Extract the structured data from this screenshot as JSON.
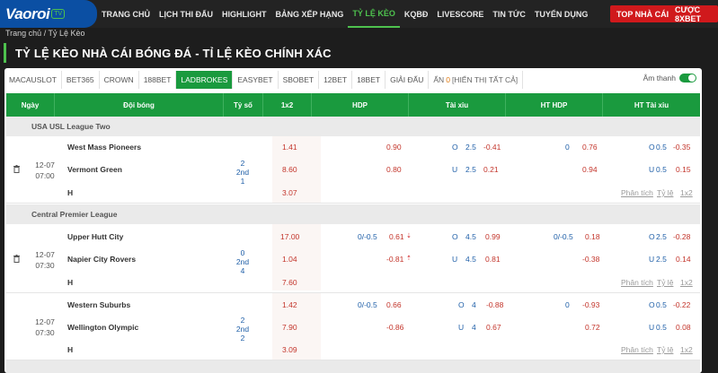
{
  "header": {
    "logo": "Vaoroi",
    "logo_badge": "TV",
    "menu": [
      "TRANG CHỦ",
      "LỊCH THI ĐẤU",
      "HIGHLIGHT",
      "BẢNG XẾP HẠNG",
      "TỶ LỆ KÈO",
      "KQBĐ",
      "LIVESCORE",
      "TIN TỨC",
      "TUYỂN DỤNG"
    ],
    "active_menu": "TỶ LỆ KÈO",
    "btn_top": "TOP NHÀ CÁI",
    "btn_bet": "CƯỢC 8XBET"
  },
  "breadcrumb": "Trang chủ  / Tỷ Lệ Kèo",
  "page_title": "TỶ LỆ KÈO NHÀ CÁI BÓNG ĐÁ - TỈ LỆ KÈO CHÍNH XÁC",
  "tabs": [
    "MACAUSLOT",
    "BET365",
    "CROWN",
    "188BET",
    "LADBROKES",
    "EASYBET",
    "SBOBET",
    "12BET",
    "18BET",
    "GIẢI ĐẤU"
  ],
  "active_tab": "LADBROKES",
  "filter": {
    "hidden_label": "ẨN",
    "hidden_count": "0",
    "show_all": "[HIỂN THỊ TẤT CẢ]"
  },
  "sound_label": "Âm thanh",
  "columns": [
    "Ngày",
    "Đội bóng",
    "Tỷ số",
    "1x2",
    "HDP",
    "Tài xỉu",
    "HT HDP",
    "HT Tài xỉu"
  ],
  "links": {
    "analysis": "Phân tích",
    "odds": "Tỷ lệ",
    "x12": "1x2"
  },
  "leagues": [
    {
      "name": "USA USL League Two",
      "match": {
        "date": "12-07",
        "time": "07:00",
        "home": "West Mass Pioneers",
        "away": "Vermont Green",
        "draw": "H",
        "score": [
          "2",
          "2nd",
          "1"
        ],
        "x12": [
          "1.41",
          "8.60",
          "3.07"
        ],
        "hdp": {
          "line1": "",
          "odd1": "0.90",
          "line2": "",
          "odd2": "0.80"
        },
        "ou": {
          "o_label": "O",
          "o_line": "2.5",
          "o_odd": "-0.41",
          "u_label": "U",
          "u_line": "2.5",
          "u_odd": "0.21"
        },
        "ht_hdp": {
          "line1": "0",
          "odd1": "0.76",
          "odd2": "0.94"
        },
        "ht_ou": {
          "o_label": "O",
          "o_line": "0.5",
          "o_odd": "-0.35",
          "u_label": "U",
          "u_line": "0.5",
          "u_odd": "0.15"
        }
      }
    },
    {
      "name": "Central Premier League",
      "match": {
        "date": "12-07",
        "time": "07:30",
        "home": "Upper Hutt City",
        "away": "Napier City Rovers",
        "draw": "H",
        "score": [
          "0",
          "2nd",
          "4"
        ],
        "x12": [
          "17.00",
          "1.04",
          "7.60"
        ],
        "hdp": {
          "line1": "0/-0.5",
          "odd1": "0.61",
          "odd2": "-0.81"
        },
        "ou": {
          "o_label": "O",
          "o_line": "4.5",
          "o_odd": "0.99",
          "u_label": "U",
          "u_line": "4.5",
          "u_odd": "0.81"
        },
        "ht_hdp": {
          "line1": "0/-0.5",
          "odd1": "0.18",
          "odd2": "-0.38"
        },
        "ht_ou": {
          "o_label": "O",
          "o_line": "2.5",
          "o_odd": "-0.28",
          "u_label": "U",
          "u_line": "2.5",
          "u_odd": "0.14"
        }
      }
    },
    {
      "name": "",
      "match": {
        "date": "12-07",
        "time": "07:30",
        "home": "Western Suburbs",
        "away": "Wellington Olympic",
        "draw": "H",
        "score": [
          "2",
          "2nd",
          "2"
        ],
        "x12": [
          "1.42",
          "7.90",
          "3.09"
        ],
        "hdp": {
          "line1": "0/-0.5",
          "odd1": "0.66",
          "odd2": "-0.86"
        },
        "ou": {
          "o_label": "O",
          "o_line": "4",
          "o_odd": "-0.88",
          "u_label": "U",
          "u_line": "4",
          "u_odd": "0.67"
        },
        "ht_hdp": {
          "line1": "0",
          "odd1": "-0.93",
          "odd2": "0.72"
        },
        "ht_ou": {
          "o_label": "O",
          "o_line": "0.5",
          "o_odd": "-0.22",
          "u_label": "U",
          "u_line": "0.5",
          "u_odd": "0.08"
        }
      }
    }
  ],
  "colors": {
    "brand_green": "#1a9a3e",
    "accent_red": "#d0191c",
    "odd_red": "#c3342a",
    "line_blue": "#1f5fa8"
  }
}
